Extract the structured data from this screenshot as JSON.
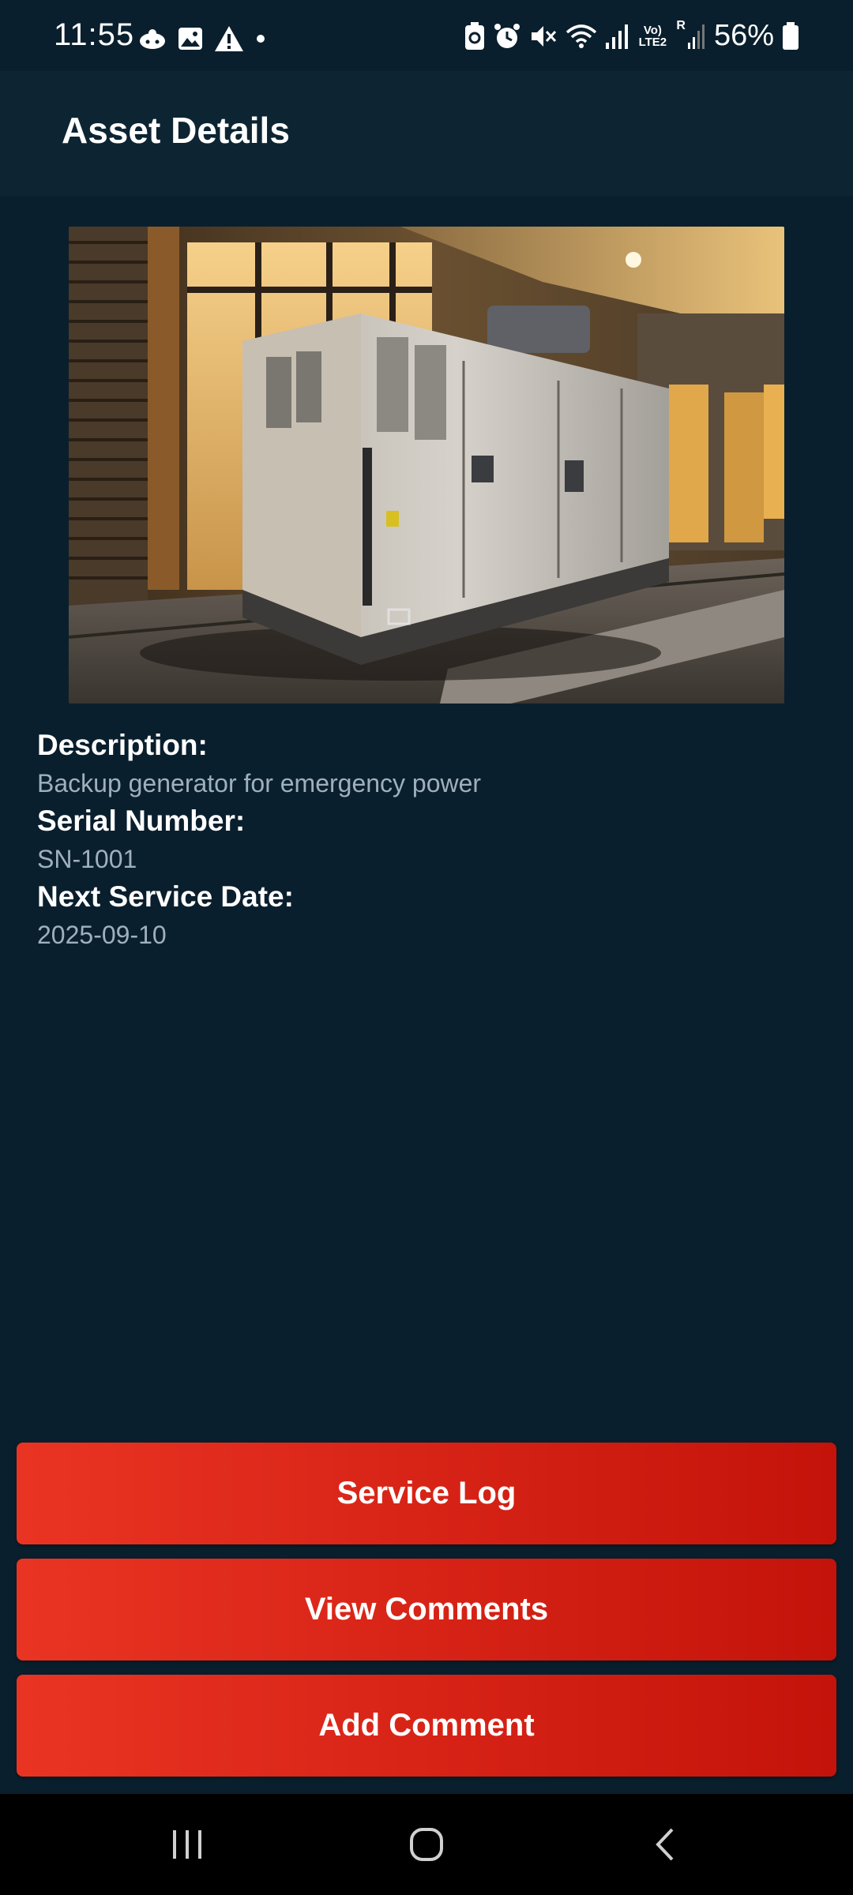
{
  "status_bar": {
    "time": "11:55",
    "battery": "56%",
    "left_icons": [
      "cloud-app-icon",
      "gallery-icon",
      "warning-icon",
      "dot-icon"
    ],
    "right_icons": [
      "battery-saver-icon",
      "alarm-icon",
      "mute-icon",
      "wifi-icon",
      "signal-icon",
      "volte-icon",
      "roaming-signal-icon",
      "battery-icon"
    ],
    "volte_label": "Vo) LTE2",
    "roaming_label": "R"
  },
  "app_bar": {
    "title": "Asset Details"
  },
  "asset": {
    "description_label": "Description:",
    "description_value": "Backup generator for emergency power",
    "serial_label": "Serial Number:",
    "serial_value": "SN-1001",
    "next_service_label": "Next Service Date:",
    "next_service_value": "2025-09-10"
  },
  "actions": {
    "service_log": "Service Log",
    "view_comments": "View Comments",
    "add_comment": "Add Comment"
  },
  "nav_bar": {
    "items": [
      "recent-apps-icon",
      "home-icon",
      "back-icon"
    ]
  },
  "colors": {
    "background": "#0a1f2d",
    "app_bar": "#0d2533",
    "button_start": "#ea3423",
    "button_end": "#c4130a",
    "value_text": "#9fb0bd"
  }
}
